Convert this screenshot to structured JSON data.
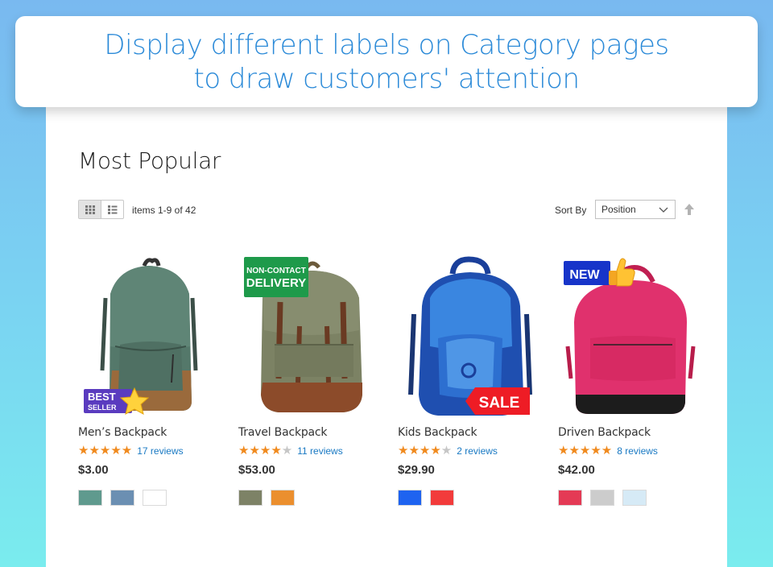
{
  "banner": {
    "line1": "Display different labels on Category pages",
    "line2": "to draw customers' attention"
  },
  "page_title": "Most Popular",
  "toolbar": {
    "items_count": "items 1-9 of 42",
    "sort_label": "Sort By",
    "sort_value": "Position"
  },
  "colors": {
    "accent": "#2b8ad8",
    "star": "#f08a1e",
    "link": "#1979c3"
  },
  "products": [
    {
      "name": "Men’s Backpack",
      "rating": 5,
      "reviews": "17 reviews",
      "price": "$3.00",
      "swatches": [
        "#5f9a8e",
        "#6b8fb2",
        "#ffffff"
      ],
      "label": {
        "type": "best-seller",
        "line1": "BEST",
        "line2": "SELLER"
      }
    },
    {
      "name": "Travel Backpack",
      "rating": 4,
      "reviews": "11 reviews",
      "price": "$53.00",
      "swatches": [
        "#7d8266",
        "#eb8f2e"
      ],
      "label": {
        "type": "non-contact",
        "line1": "NON-CONTACT",
        "line2": "DELIVERY"
      }
    },
    {
      "name": "Kids Backpack",
      "rating": 4,
      "reviews": "2 reviews",
      "price": "$29.90",
      "swatches": [
        "#1e63f0",
        "#f23b3b"
      ],
      "label": {
        "type": "sale",
        "text": "SALE"
      }
    },
    {
      "name": "Driven Backpack",
      "rating": 5,
      "reviews": "8 reviews",
      "price": "$42.00",
      "swatches": [
        "#e43a55",
        "#cccccc",
        "#d6eaf6"
      ],
      "label": {
        "type": "new",
        "text": "NEW"
      }
    }
  ]
}
